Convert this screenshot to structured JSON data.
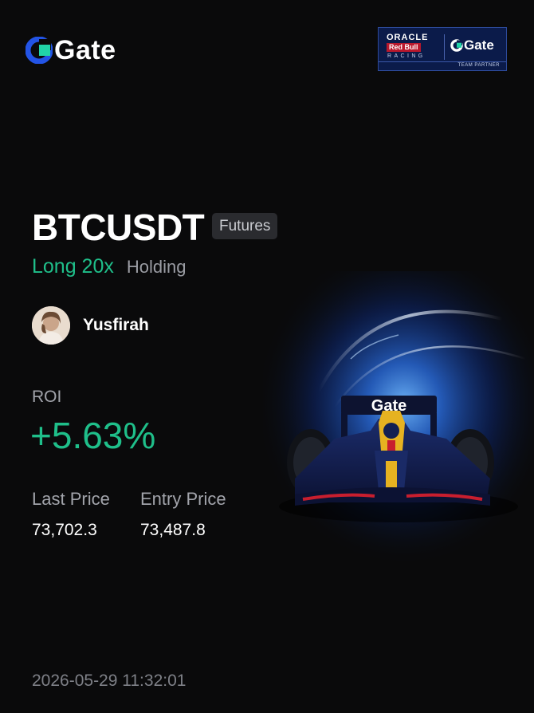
{
  "brand": {
    "name": "Gate",
    "accent_color": "#2354e6",
    "icon": "gate-logo-icon"
  },
  "partner_badge": {
    "line1": "ORACLE",
    "line2": "Red Bull",
    "line3": "RACING",
    "brand": "Gate",
    "caption": "TEAM PARTNER",
    "background_color": "#0b1b4a"
  },
  "position": {
    "symbol": "BTCUSDT",
    "type_tag": "Futures",
    "direction": "Long 20x",
    "direction_color": "#1fbf8a",
    "status": "Holding"
  },
  "user": {
    "name": "Yusfirah",
    "avatar_icon": "user-avatar"
  },
  "roi": {
    "label": "ROI",
    "value": "+5.63%",
    "color": "#1fbf8a"
  },
  "prices": {
    "last_label": "Last Price",
    "last_value": "73,702.3",
    "entry_label": "Entry Price",
    "entry_value": "73,487.8"
  },
  "footer": {
    "timestamp": "2026-05-29 11:32:01"
  },
  "hero_image": {
    "icon": "f1-race-car-illustration",
    "car_sponsor_text": "Gate"
  }
}
